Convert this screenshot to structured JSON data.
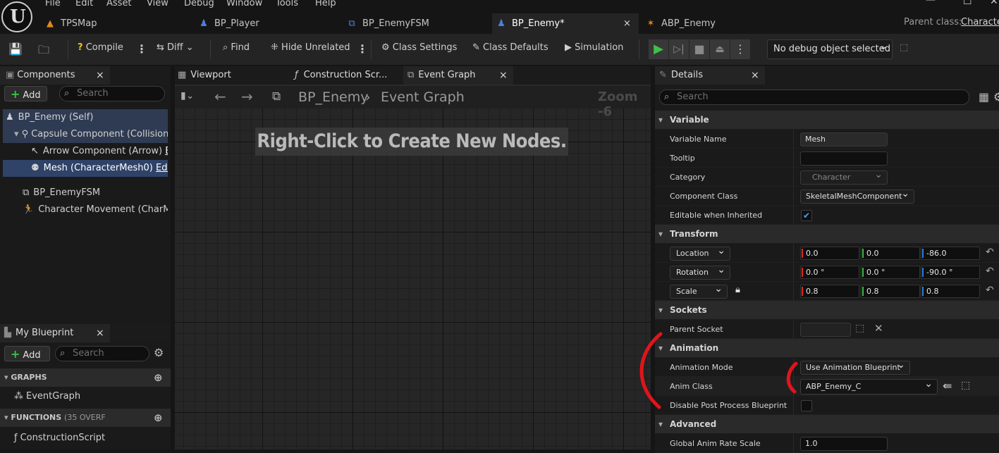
{
  "menu": [
    "File",
    "Edit",
    "Asset",
    "View",
    "Debug",
    "Window",
    "Tools",
    "Help"
  ],
  "tabs": [
    {
      "label": "TPSMap",
      "icon": "▲",
      "color": "#e08a1c"
    },
    {
      "label": "BP_Player",
      "icon": "♟",
      "color": "#4d7fe0"
    },
    {
      "label": "BP_EnemyFSM",
      "icon": "⧉",
      "color": "#4d7fe0"
    },
    {
      "label": "BP_Enemy*",
      "icon": "♟",
      "color": "#4d7fe0"
    },
    {
      "label": "ABP_Enemy",
      "icon": "✶",
      "color": "#e08a1c"
    }
  ],
  "tab_close": "×",
  "parent_class_label": "Parent class:",
  "parent_class_value": "Character",
  "toolbar": {
    "compile": "Compile",
    "diff": "Diff",
    "find": "Find",
    "hide_unrelated": "Hide Unrelated",
    "class_settings": "Class Settings",
    "class_defaults": "Class Defaults",
    "simulation": "Simulation",
    "debug_object": "No debug object selected"
  },
  "components": {
    "tab": "Components",
    "add": "Add",
    "search_placeholder": "Search",
    "items": [
      "BP_Enemy (Self)",
      "Capsule Component (CollisionCy",
      "Arrow Component (Arrow)",
      "Mesh (CharacterMesh0)",
      "BP_EnemyFSM",
      "Character Movement (CharMove"
    ],
    "edit_partial": "Ed",
    "edit": "Edit"
  },
  "my_blueprint": {
    "tab": "My Blueprint",
    "add": "Add",
    "search_placeholder": "Search",
    "graphs_header": "GRAPHS",
    "graph_item": "EventGraph",
    "functions_header": "FUNCTIONS",
    "functions_count": "(35 OVERF",
    "function_item": "ConstructionScript"
  },
  "editor_tabs": {
    "viewport": "Viewport",
    "construction": "Construction Scr...",
    "event_graph": "Event Graph"
  },
  "graph": {
    "breadcrumb_root": "BP_Enemy",
    "breadcrumb_leaf": "Event Graph",
    "zoom": "Zoom -6",
    "hint": "Right-Click to Create New Nodes."
  },
  "details": {
    "tab": "Details",
    "search_placeholder": "Search",
    "variable": {
      "header": "Variable",
      "name_label": "Variable Name",
      "name_value": "Mesh",
      "tooltip_label": "Tooltip",
      "category_label": "Category",
      "category_value": "Character",
      "component_class_label": "Component Class",
      "component_class_value": "SkeletalMeshComponent",
      "editable_label": "Editable when Inherited"
    },
    "transform": {
      "header": "Transform",
      "location": "Location",
      "rotation": "Rotation",
      "scale": "Scale",
      "loc": [
        "0.0",
        "0.0",
        "-86.0"
      ],
      "rot": [
        "0.0 °",
        "0.0 °",
        "-90.0 °"
      ],
      "scl": [
        "0.8",
        "0.8",
        "0.8"
      ]
    },
    "sockets": {
      "header": "Sockets",
      "parent_socket_label": "Parent Socket"
    },
    "animation": {
      "header": "Animation",
      "mode_label": "Animation Mode",
      "mode_value": "Use Animation Blueprint",
      "class_label": "Anim Class",
      "class_value": "ABP_Enemy_C",
      "post_label": "Disable Post Process Blueprint"
    },
    "advanced": {
      "header": "Advanced",
      "rate_label": "Global Anim Rate Scale",
      "rate_value": "1.0"
    }
  },
  "annotation_color": "#e1141b"
}
